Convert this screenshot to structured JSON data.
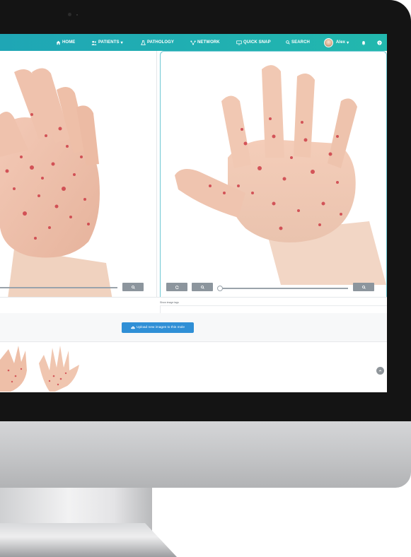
{
  "nav": {
    "items": [
      {
        "label": "HOME",
        "icon": "home-icon"
      },
      {
        "label": "PATIENTS",
        "icon": "patients-icon",
        "caret": "▾"
      },
      {
        "label": "PATHOLOGY",
        "icon": "flask-icon"
      },
      {
        "label": "NETWORK",
        "icon": "network-icon"
      },
      {
        "label": "QUICK SNAP",
        "icon": "monitor-icon"
      },
      {
        "label": "SEARCH",
        "icon": "search-icon"
      }
    ],
    "user": {
      "name": "Alex",
      "caret": "▾"
    },
    "icons": [
      "bell-icon",
      "help-icon"
    ]
  },
  "panels": {
    "tags_label": "Show image tags"
  },
  "upload": {
    "label": "Upload new images to this mole"
  },
  "colors": {
    "nav_start": "#1fa6b5",
    "nav_end": "#22b8ae",
    "panel_border": "#6fc8d3",
    "upload_button": "#2f8fd6",
    "control_button": "#8c959d"
  }
}
